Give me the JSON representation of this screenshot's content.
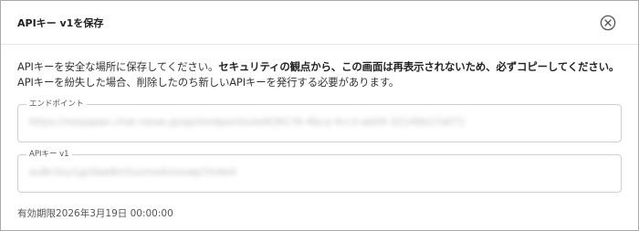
{
  "dialog": {
    "title": "APIキー v1を保存",
    "close_icon": "close-circle-icon"
  },
  "message": {
    "part1": "APIキーを安全な場所に保存してください。",
    "bold": "セキュリティの観点から、この画面は再表示されないため、必ずコピーしてください。",
    "part2": "APIキーを紛失した場合、削除したのち新しいAPIキーを発行する必要があります。"
  },
  "endpoint": {
    "label": "エンドポイント",
    "value": "https://neojapan.chat.neoai.jp/api/endpoints/ed43617b-4bca-4cc3-ab04-32140b17a071"
  },
  "api_key": {
    "label": "APIキー v1",
    "value": "eu8n3xy1gs0aw8m5uvma4vtxowp7m4e4"
  },
  "expiry": {
    "text": "有効期限2026年3月19日 00:00:00"
  }
}
